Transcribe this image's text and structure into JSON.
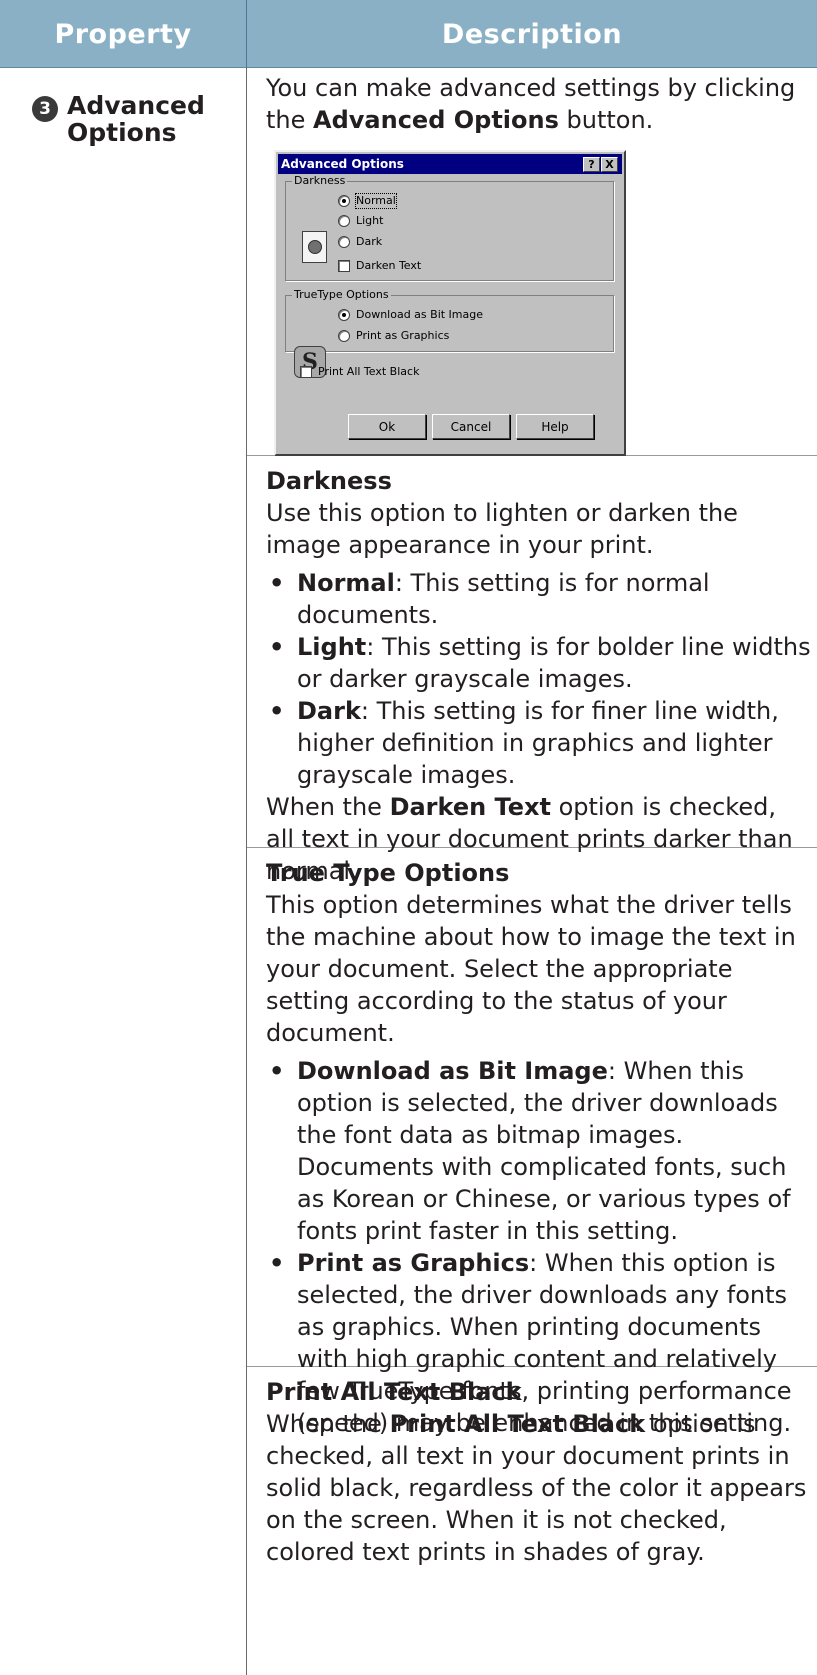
{
  "table": {
    "headers": {
      "property": "Property",
      "description": "Description"
    },
    "row_number": "3",
    "property_label": "Advanced Options"
  },
  "intro": {
    "text_before": "You can make advanced settings by clicking the ",
    "bold": "Advanced Options",
    "text_after": " button."
  },
  "dialog": {
    "title": "Advanced Options",
    "help_glyph": "?",
    "close_glyph": "X",
    "darkness_group": "Darkness",
    "darkness_options": [
      "Normal",
      "Light",
      "Dark"
    ],
    "darkness_selected": "Normal",
    "darken_text": "Darken Text",
    "truetype_group": "TrueType Options",
    "truetype_options": [
      "Download as Bit Image",
      "Print as Graphics"
    ],
    "truetype_selected": "Download as Bit Image",
    "print_all_black": "Print All Text Black",
    "buttons": {
      "ok": "Ok",
      "cancel": "Cancel",
      "help": "Help"
    },
    "icon_names": {
      "darkness": "document-darkness-icon",
      "truetype": "truetype-icon"
    }
  },
  "darkness": {
    "title": "Darkness",
    "desc": "Use this option to lighten or darken the image appearance in your print.",
    "items": [
      {
        "label": "Normal",
        "text": ": This setting is for normal documents."
      },
      {
        "label": "Light",
        "text": ": This setting is for bolder line widths or darker grayscale images."
      },
      {
        "label": "Dark",
        "text": ": This setting is for finer line width, higher definition in graphics and lighter grayscale images."
      }
    ],
    "note_before": "When the ",
    "note_bold": "Darken Text",
    "note_after": " option is checked, all text in your document prints darker than normal."
  },
  "truetype": {
    "title": "True Type Options",
    "desc": "This option determines what the driver tells the machine about how to image the text in your document. Select the appropriate setting according to the status of your document.",
    "items": [
      {
        "label": "Download as Bit Image",
        "text": ": When this option is selected, the driver downloads the font data as bitmap images. Documents with complicated fonts, such as Korean or Chinese, or various types of fonts print faster in this setting."
      },
      {
        "label": "Print as Graphics",
        "text": ": When this option is selected, the driver downloads any fonts as graphics. When printing documents with high graphic content and relatively few TrueType fonts, printing performance (speed) may be enhanced in this setting."
      }
    ]
  },
  "print_black": {
    "title": "Print All Text Black",
    "before": "When the ",
    "bold": "Print All Text Black",
    "after": " option is checked, all text in your document prints in solid black, regardless of the color it appears on the screen. When it is not checked, colored text prints in shades of gray."
  }
}
